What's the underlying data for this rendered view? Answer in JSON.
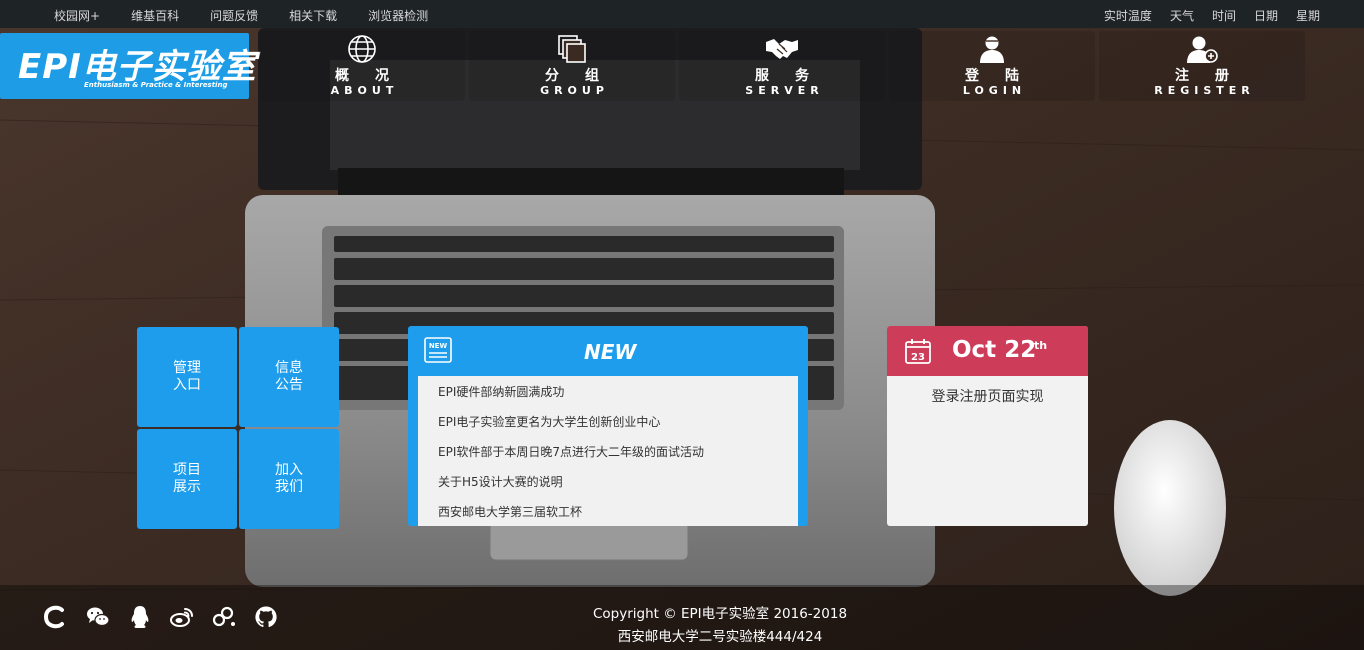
{
  "topbar": {
    "links": [
      "校园网+",
      "维基百科",
      "问题反馈",
      "相关下载",
      "浏览器检测"
    ],
    "info": [
      "实时温度",
      "天气",
      "时间",
      "日期",
      "星期"
    ]
  },
  "logo": {
    "text": "EPI电子实验室",
    "slogan": "Enthusiasm & Practice & Interesting"
  },
  "nav": [
    {
      "cn": "概况",
      "en": "ABOUT",
      "icon": "globe-icon"
    },
    {
      "cn": "分组",
      "en": "GROUP",
      "icon": "layers-icon"
    },
    {
      "cn": "服务",
      "en": "SERVER",
      "icon": "handshake-icon"
    },
    {
      "cn": "登陆",
      "en": "LOGIN",
      "icon": "user-icon"
    },
    {
      "cn": "注册",
      "en": "REGISTER",
      "icon": "user-add-icon"
    }
  ],
  "tiles": [
    {
      "line1": "管理",
      "line2": "入口"
    },
    {
      "line1": "信息",
      "line2": "公告"
    },
    {
      "line1": "项目",
      "line2": "展示"
    },
    {
      "line1": "加入",
      "line2": "我们"
    }
  ],
  "news": {
    "badge": "NEW",
    "title": "NEW",
    "items": [
      "EPI硬件部纳新圆满成功",
      "EPI电子实验室更名为大学生创新创业中心",
      "EPI软件部于本周日晚7点进行大二年级的面试活动",
      "关于H5设计大赛的说明",
      "西安邮电大学第三届软工杯"
    ]
  },
  "calendar": {
    "day_icon": "23",
    "date": "Oct 22",
    "suffix": "th",
    "note": "登录注册页面实现"
  },
  "footer": {
    "copyright": "Copyright © EPI电子实验室 2016-2018",
    "address": "西安邮电大学二号实验楼444/424",
    "social": [
      "csdn-icon",
      "wechat-icon",
      "qq-icon",
      "weibo-icon",
      "zhihu-icon",
      "github-icon"
    ]
  },
  "colors": {
    "accent": "#1d9deb",
    "calendar": "#cd3d5a",
    "topbar": "#1e2326"
  }
}
